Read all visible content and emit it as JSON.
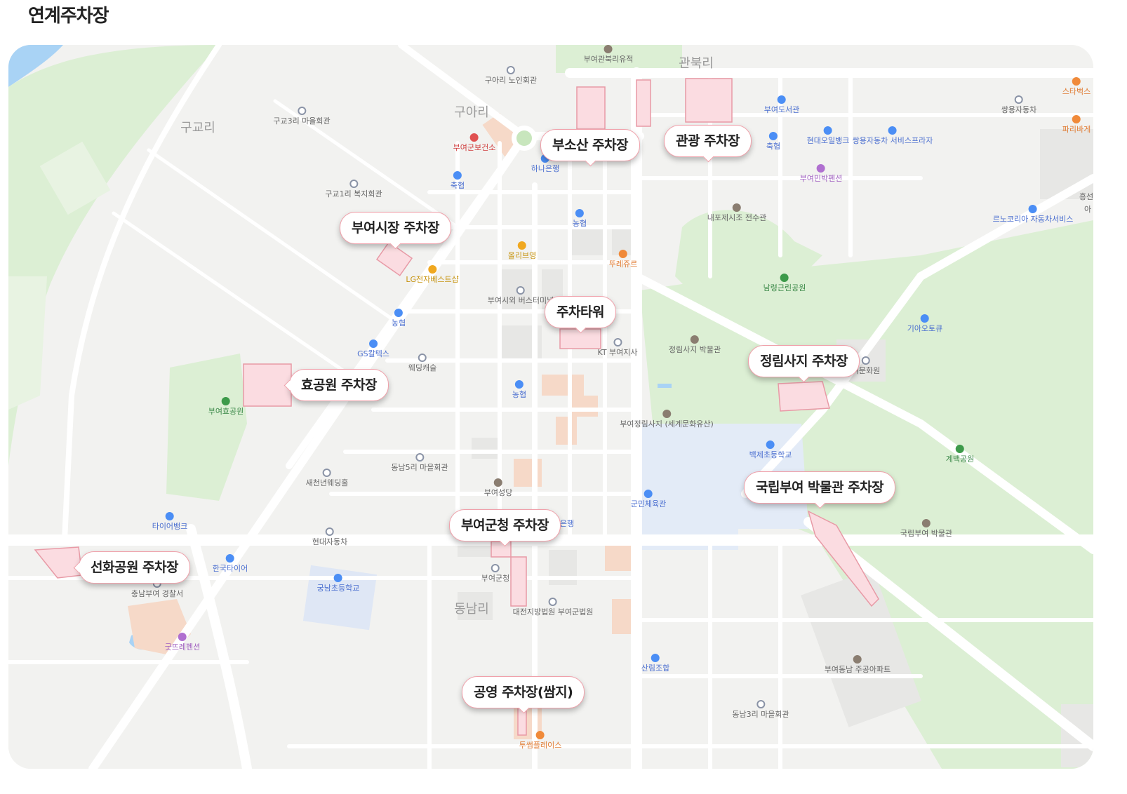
{
  "page": {
    "title": "연계주차장"
  },
  "colors": {
    "road": "#ffffff",
    "land": "#f2f2f0",
    "park": "#dcefd4",
    "water": "#a9d3f5",
    "parking_fill": "#fbdce1",
    "parking_stroke": "#e89aa6",
    "block": "#e7e7e5",
    "building_warm": "#f6d9c8"
  },
  "callouts": [
    {
      "id": "busosan",
      "label": "부소산 주차장",
      "tail": "bottom"
    },
    {
      "id": "gwangwang",
      "label": "관광 주차장",
      "tail": "bottom"
    },
    {
      "id": "market",
      "label": "부여시장 주차장",
      "tail": "bottom"
    },
    {
      "id": "tower",
      "label": "주차타워",
      "tail": "bottom"
    },
    {
      "id": "jeongnimsaji",
      "label": "정림사지 주차장",
      "tail": "bottom"
    },
    {
      "id": "hyogongwon",
      "label": "효공원 주차장",
      "tail": "left"
    },
    {
      "id": "museum",
      "label": "국립부여 박물관 주차장",
      "tail": "bottom"
    },
    {
      "id": "county",
      "label": "부여군청 주차장",
      "tail": "bottom"
    },
    {
      "id": "seonhwa",
      "label": "선화공원 주차장",
      "tail": "left"
    },
    {
      "id": "public",
      "label": "공영 주차장(쌈지)",
      "tail": "bottom"
    }
  ],
  "districts": [
    "구교리",
    "구아리",
    "관북리",
    "동남리"
  ],
  "pois": [
    {
      "label": "부여관북리유적",
      "icon": "landmark-icon",
      "color": "brown"
    },
    {
      "label": "구아리 노인회관",
      "icon": "community-center-icon",
      "color": "gray"
    },
    {
      "label": "구교3리 마을회관",
      "icon": "community-center-icon",
      "color": "gray"
    },
    {
      "label": "부여군보건소",
      "icon": "hospital-icon",
      "color": "red"
    },
    {
      "label": "하나은행",
      "icon": "bank-icon",
      "color": "blue"
    },
    {
      "label": "축협",
      "icon": "bank-icon",
      "color": "blue"
    },
    {
      "label": "구교1리 복지회관",
      "icon": "community-center-icon",
      "color": "gray"
    },
    {
      "label": "농협",
      "icon": "bank-icon",
      "color": "blue"
    },
    {
      "label": "올리브영",
      "icon": "shop-icon",
      "color": "gold"
    },
    {
      "label": "뚜레쥬르",
      "icon": "bakery-icon",
      "color": "orange"
    },
    {
      "label": "LG전자베스트샵",
      "icon": "shop-icon",
      "color": "gold"
    },
    {
      "label": "부여시외 버스터미널",
      "icon": "bus-terminal-icon",
      "color": "gray"
    },
    {
      "label": "농협",
      "icon": "bank-icon",
      "color": "blue"
    },
    {
      "label": "GS칼텍스",
      "icon": "gas-station-icon",
      "color": "blue"
    },
    {
      "label": "웨딩캐슬",
      "icon": "wedding-icon",
      "color": "gray"
    },
    {
      "label": "KT 부여지사",
      "icon": "office-icon",
      "color": "gray"
    },
    {
      "label": "농협",
      "icon": "bank-icon",
      "color": "blue"
    },
    {
      "label": "부여효공원",
      "icon": "park-icon",
      "color": "green"
    },
    {
      "label": "부여도서관",
      "icon": "library-icon",
      "color": "blue"
    },
    {
      "label": "축협",
      "icon": "bank-icon",
      "color": "blue"
    },
    {
      "label": "현대오일뱅크",
      "icon": "gas-station-icon",
      "color": "blue"
    },
    {
      "label": "쌍용자동차 서비스프라자",
      "icon": "car-repair-icon",
      "color": "blue"
    },
    {
      "label": "쌍용자동차",
      "icon": "car-icon",
      "color": "gray"
    },
    {
      "label": "스타벅스",
      "icon": "cafe-icon",
      "color": "orange"
    },
    {
      "label": "파리바게",
      "icon": "bakery-icon",
      "color": "orange"
    },
    {
      "label": "부여민박펜션",
      "icon": "lodging-icon",
      "color": "purple"
    },
    {
      "label": "내포제시조 전수관",
      "icon": "culture-icon",
      "color": "brown"
    },
    {
      "label": "르노코리아 자동차서비스",
      "icon": "car-repair-icon",
      "color": "blue"
    },
    {
      "label": "남령근린공원",
      "icon": "park-icon",
      "color": "green"
    },
    {
      "label": "기아오토큐",
      "icon": "car-repair-icon",
      "color": "blue"
    },
    {
      "label": "정림사지 박물관",
      "icon": "museum-icon",
      "color": "brown"
    },
    {
      "label": "여문화원",
      "icon": "culture-icon",
      "color": "gray"
    },
    {
      "label": "부여정림사지 (세계문화유산)",
      "icon": "heritage-icon",
      "color": "brown"
    },
    {
      "label": "백제초등학교",
      "icon": "school-icon",
      "color": "blue"
    },
    {
      "label": "계백공원",
      "icon": "park-icon",
      "color": "green"
    },
    {
      "label": "동남5리 마을회관",
      "icon": "community-center-icon",
      "color": "gray"
    },
    {
      "label": "새천년웨딩홀",
      "icon": "wedding-icon",
      "color": "gray"
    },
    {
      "label": "부여성당",
      "icon": "church-icon",
      "color": "brown"
    },
    {
      "label": "군민체육관",
      "icon": "gym-icon",
      "color": "blue"
    },
    {
      "label": "타이어뱅크",
      "icon": "car-repair-icon",
      "color": "blue"
    },
    {
      "label": "현대자동차",
      "icon": "car-icon",
      "color": "gray"
    },
    {
      "label": "한국타이어",
      "icon": "car-repair-icon",
      "color": "blue"
    },
    {
      "label": "국립부여 박물관",
      "icon": "museum-icon",
      "color": "brown"
    },
    {
      "label": "충남부여 경찰서",
      "icon": "police-icon",
      "color": "gray"
    },
    {
      "label": "궁남초등학교",
      "icon": "school-icon",
      "color": "blue"
    },
    {
      "label": "부여군청",
      "icon": "government-icon",
      "color": "gray"
    },
    {
      "label": "대전지방법원 부여군법원",
      "icon": "court-icon",
      "color": "gray"
    },
    {
      "label": "굿뜨레펜션",
      "icon": "lodging-icon",
      "color": "purple"
    },
    {
      "label": "산림조합",
      "icon": "bank-icon",
      "color": "blue"
    },
    {
      "label": "부여동남 주공아파트",
      "icon": "apartment-icon",
      "color": "brown"
    },
    {
      "label": "동남3리 마을회관",
      "icon": "community-center-icon",
      "color": "gray"
    },
    {
      "label": "투썸플레이스",
      "icon": "cafe-icon",
      "color": "orange"
    },
    {
      "label": "은행",
      "icon": "bank-icon",
      "color": "blue"
    },
    {
      "label": "흥선",
      "icon": "place-icon",
      "color": "gray"
    },
    {
      "label": "아",
      "icon": "place-icon",
      "color": "gray"
    }
  ]
}
